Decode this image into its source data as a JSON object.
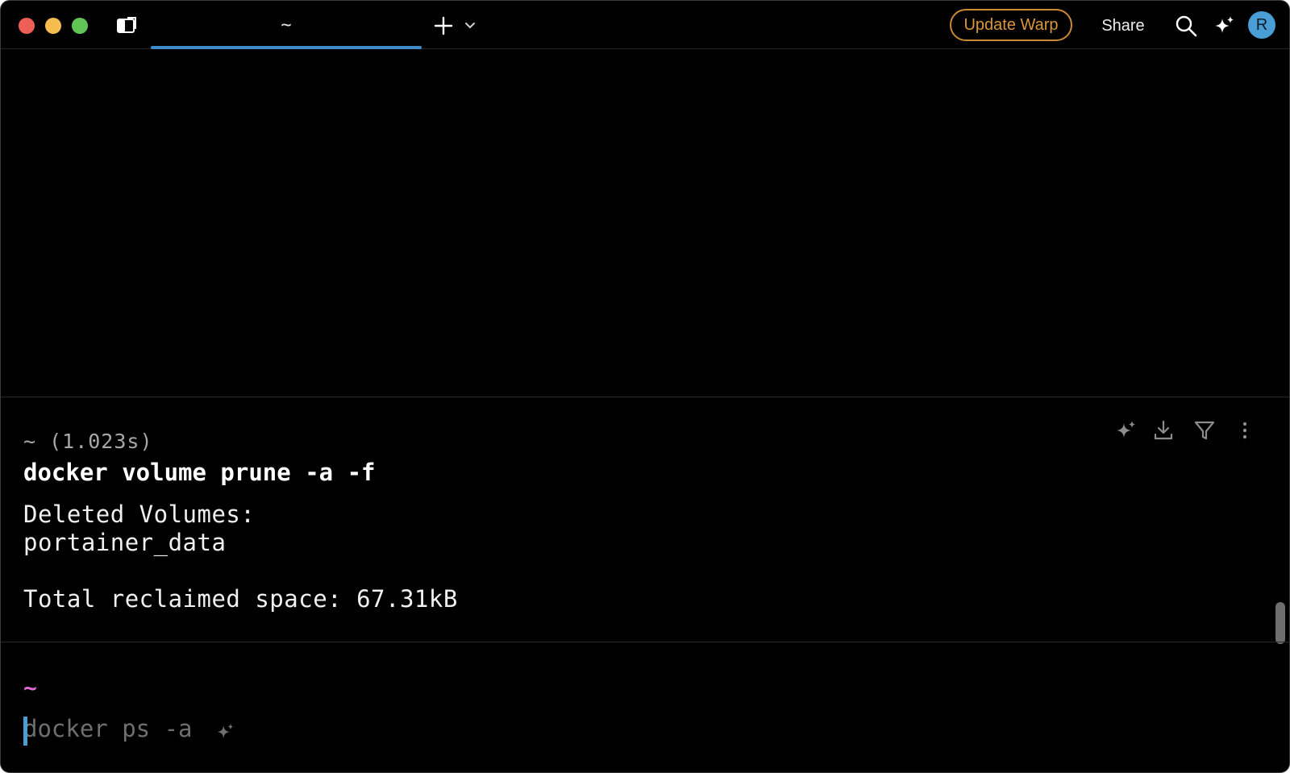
{
  "titlebar": {
    "tab_label": "~",
    "update_label": "Update Warp",
    "share_label": "Share",
    "avatar_letter": "R"
  },
  "block": {
    "meta": "~ (1.023s)",
    "command": "docker volume prune -a -f",
    "output_lines": [
      "Deleted Volumes:",
      "portainer_data",
      "",
      "Total reclaimed space: 67.31kB"
    ]
  },
  "prompt": {
    "dir": "~",
    "placeholder": "docker ps -a"
  },
  "icons": {
    "panels": "panels-icon",
    "new_tab": "plus-icon",
    "tab_menu": "chevron-down-icon",
    "search": "search-icon",
    "ai": "sparkle-icon",
    "block_ai": "sparkle-icon",
    "download": "download-icon",
    "filter": "filter-icon",
    "more": "more-vertical-icon"
  },
  "colors": {
    "background": "#000000",
    "accent": "#3d8ac8",
    "update_button": "#d9963c",
    "prompt_dir": "#e06ad6",
    "placeholder": "#6f6f6f"
  }
}
